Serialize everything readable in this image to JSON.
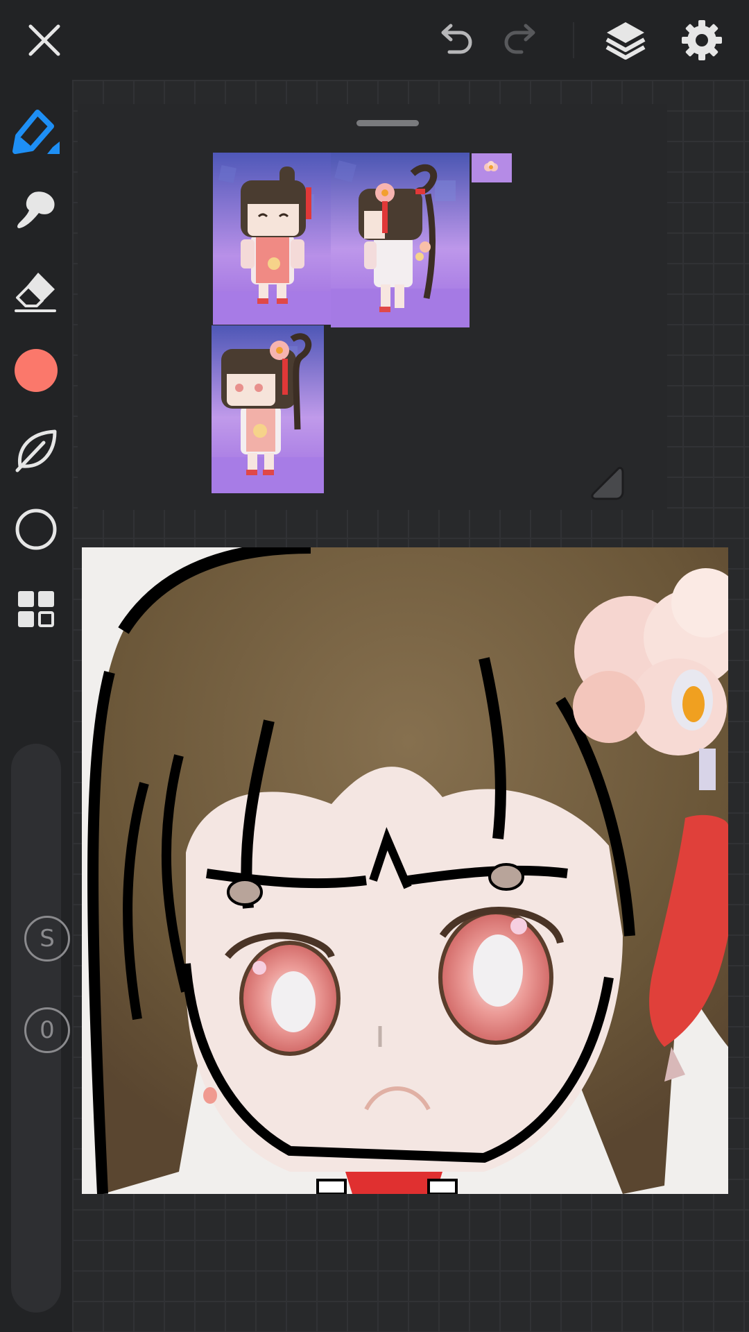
{
  "app": {
    "name": "drawing-canvas",
    "accent_color": "#1e8ff5",
    "background_color": "#222325"
  },
  "toolbar_top": {
    "icons": [
      "close-icon",
      "undo-icon",
      "redo-icon",
      "layers-icon",
      "settings-icon"
    ],
    "redo_enabled": false
  },
  "tools": {
    "selected": "pencil",
    "items": [
      "pencil-icon",
      "smudge-icon",
      "eraser-icon",
      "color-swatch",
      "leaf-brush-icon",
      "circle-shape-icon",
      "grid-palette-icon"
    ],
    "current_color": "#fb786b"
  },
  "sliders": {
    "size_label": "S",
    "opacity_label": "0"
  },
  "reference_panel": {
    "thumbnails": [
      "ref-front-view",
      "ref-side-view",
      "ref-small-flower",
      "ref-three-quarter-view"
    ]
  }
}
